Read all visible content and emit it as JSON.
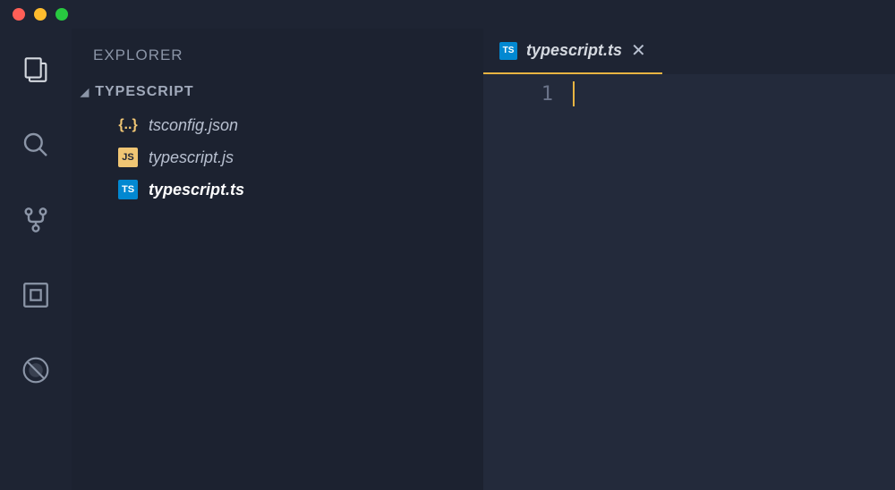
{
  "sidebar": {
    "title": "EXPLORER",
    "folder_name": "TYPESCRIPT",
    "files": [
      {
        "name": "tsconfig.json",
        "icon_label": "{..}",
        "type": "json"
      },
      {
        "name": "typescript.js",
        "icon_label": "JS",
        "type": "js"
      },
      {
        "name": "typescript.ts",
        "icon_label": "TS",
        "type": "ts"
      }
    ]
  },
  "tabs": [
    {
      "name": "typescript.ts",
      "icon_label": "TS"
    }
  ],
  "editor": {
    "line_numbers": [
      "1"
    ]
  }
}
